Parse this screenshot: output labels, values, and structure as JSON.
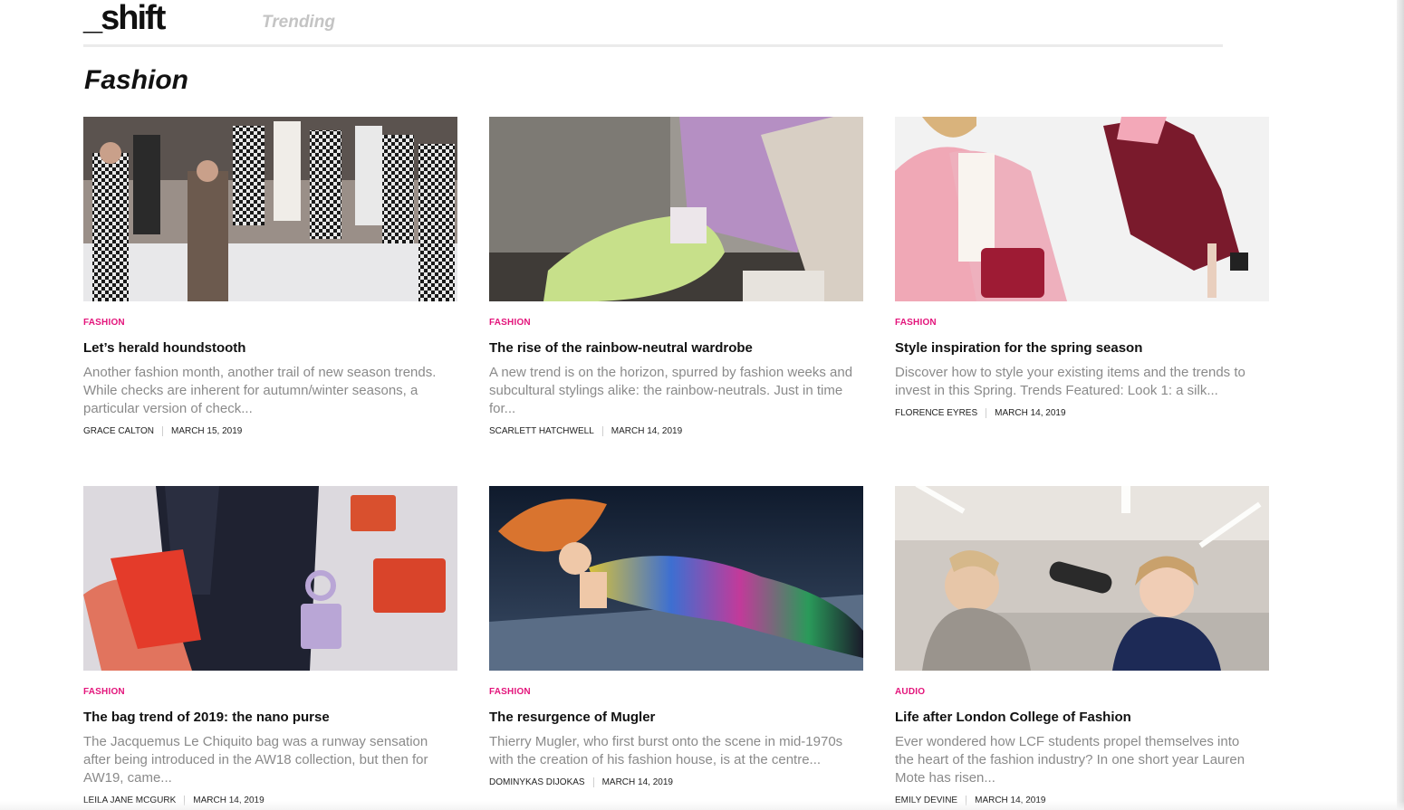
{
  "header": {
    "logo": "_shift",
    "nav_trending": "Trending"
  },
  "page": {
    "title": "Fashion"
  },
  "articles": [
    {
      "category": "FASHION",
      "title": "Let’s herald houndstooth",
      "excerpt": "Another fashion month, another trail of new season trends. While checks are inherent for autumn/winter seasons, a particular version of check...",
      "author": "GRACE CALTON",
      "date": "MARCH 15, 2019"
    },
    {
      "category": "FASHION",
      "title": "The rise of the rainbow-neutral wardrobe",
      "excerpt": "A new trend is on the horizon, spurred by fashion weeks and subcultural stylings alike: the rainbow-neutrals. Just in time for...",
      "author": "SCARLETT HATCHWELL",
      "date": "MARCH 14, 2019"
    },
    {
      "category": "FASHION",
      "title": "Style inspiration for the spring season",
      "excerpt": "Discover how to style your existing items and the trends to invest in this Spring. Trends Featured: Look 1: a silk...",
      "author": "FLORENCE EYRES",
      "date": "MARCH 14, 2019"
    },
    {
      "category": "FASHION",
      "title": "The bag trend of 2019: the nano purse",
      "excerpt": "The Jacquemus Le Chiquito bag was a runway sensation after being introduced in the AW18 collection, but then for AW19, came...",
      "author": "LEILA JANE MCGURK",
      "date": "MARCH 14, 2019"
    },
    {
      "category": "FASHION",
      "title": "The resurgence of Mugler",
      "excerpt": "Thierry Mugler, who first burst onto the scene in mid-1970s with the creation of his fashion house, is at the centre...",
      "author": "DOMINYKAS DIJOKAS",
      "date": "MARCH 14, 2019"
    },
    {
      "category": "AUDIO",
      "title": "Life after London College of Fashion",
      "excerpt": "Ever wondered how LCF students propel themselves into the heart of the fashion industry? In one short year Lauren Mote has risen...",
      "author": "EMILY DEVINE",
      "date": "MARCH 14, 2019"
    }
  ]
}
